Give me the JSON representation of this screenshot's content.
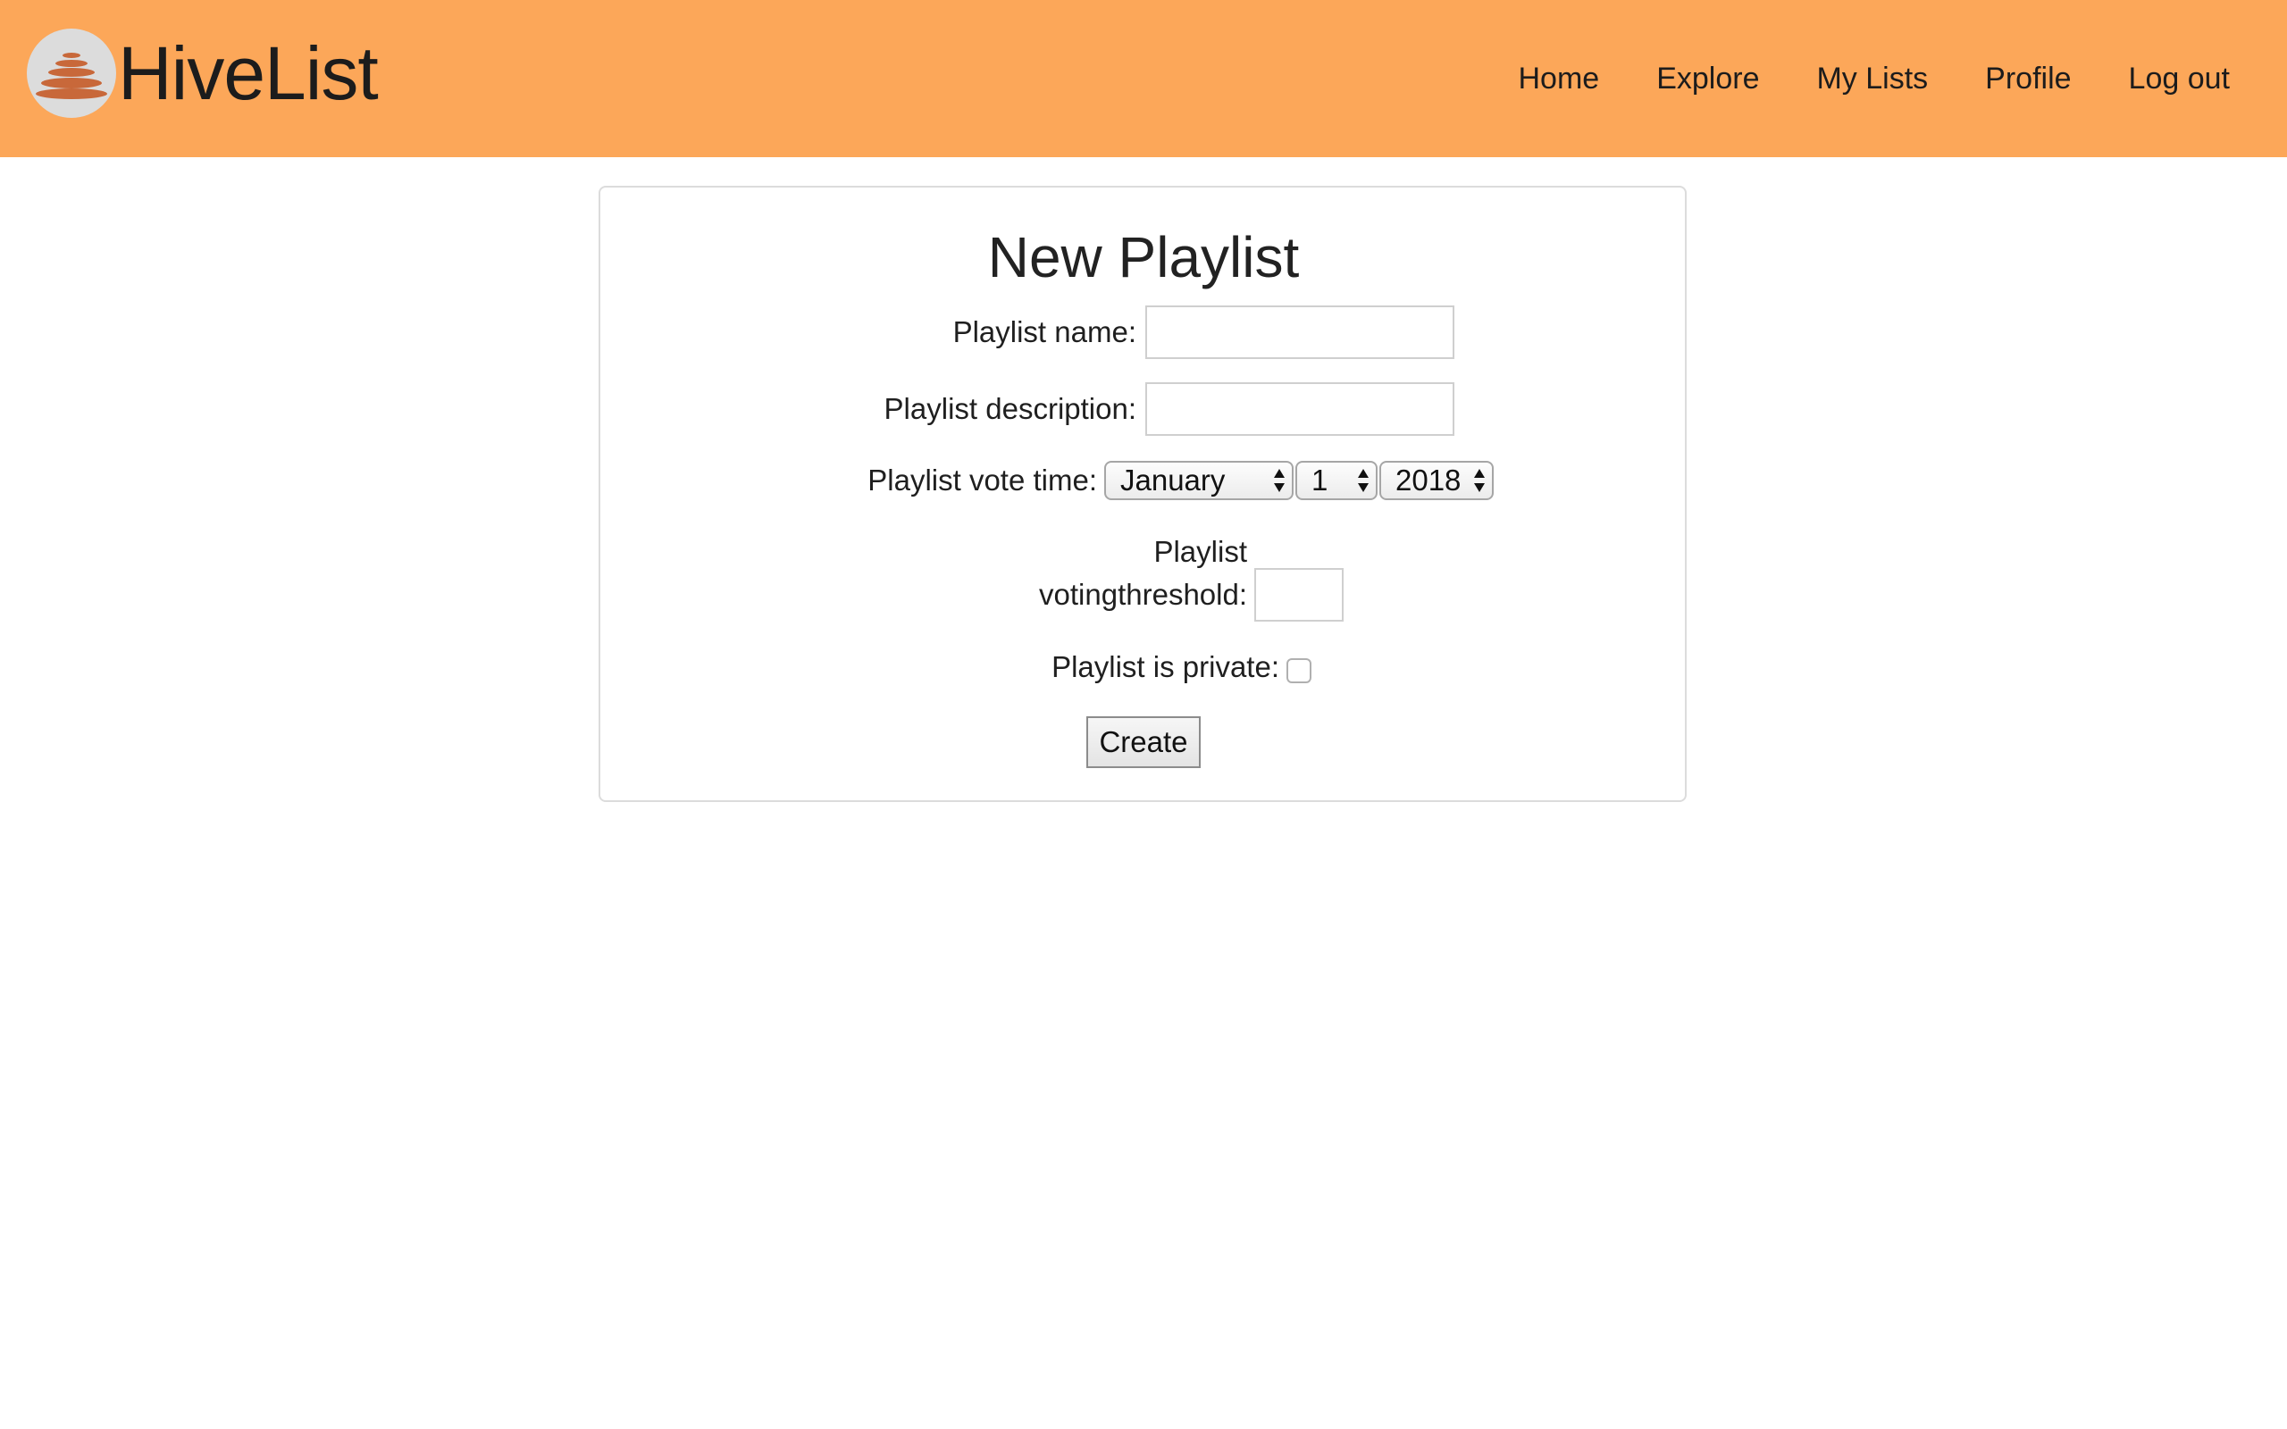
{
  "brand": {
    "name": "HiveList",
    "logo_icon": "hive-logo-icon"
  },
  "nav": {
    "items": [
      {
        "label": "Home"
      },
      {
        "label": "Explore"
      },
      {
        "label": "My Lists"
      },
      {
        "label": "Profile"
      },
      {
        "label": "Log out"
      }
    ]
  },
  "form": {
    "title": "New Playlist",
    "name_label": "Playlist name:",
    "name_value": "",
    "description_label": "Playlist description:",
    "description_value": "",
    "vote_time_label": "Playlist vote time:",
    "vote_time": {
      "month": "January",
      "day": "1",
      "year": "2018"
    },
    "threshold_label_line1": "Playlist",
    "threshold_label_line2": "votingthreshold:",
    "threshold_value": "",
    "private_label": "Playlist is private:",
    "private_checked": false,
    "submit_label": "Create"
  },
  "colors": {
    "navbar": "#fca759",
    "logo_accent": "#c8683a",
    "logo_bg": "#dcdcdc"
  }
}
